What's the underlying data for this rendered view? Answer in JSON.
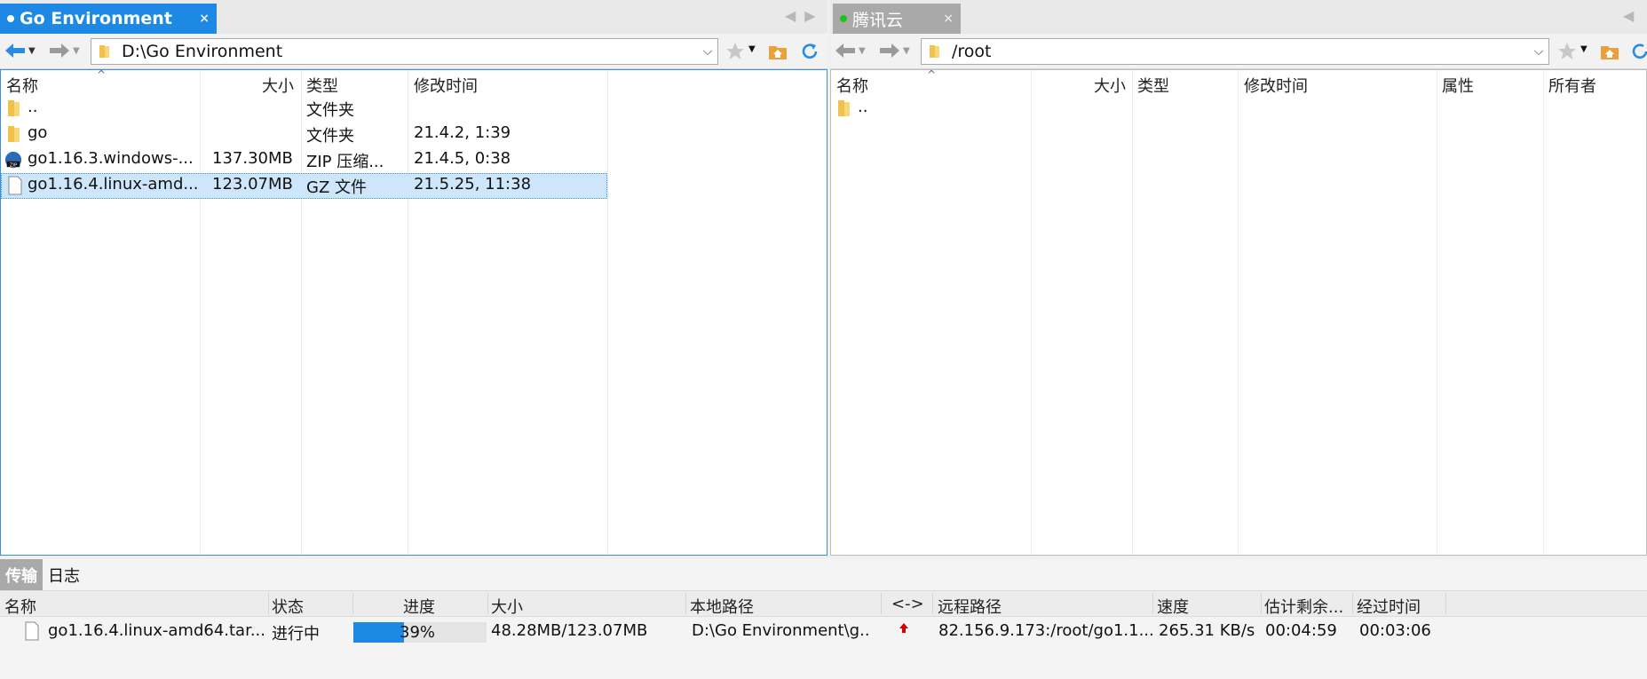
{
  "left": {
    "tab": {
      "label": "Go Environment",
      "close": "×"
    },
    "path": "D:\\Go Environment",
    "columns": {
      "name": "名称",
      "size": "大小",
      "type": "类型",
      "modified": "修改时间"
    },
    "files": [
      {
        "name": "..",
        "size": "",
        "type": "文件夹",
        "modified": "",
        "icon": "folder-icon"
      },
      {
        "name": "go",
        "size": "",
        "type": "文件夹",
        "modified": "21.4.2, 1:39",
        "icon": "folder-icon"
      },
      {
        "name": "go1.16.3.windows-...",
        "size": "137.30MB",
        "type": "ZIP 压缩...",
        "modified": "21.4.5, 0:38",
        "icon": "zip-file-icon"
      },
      {
        "name": "go1.16.4.linux-amd...",
        "size": "123.07MB",
        "type": "GZ 文件",
        "modified": "21.5.25, 11:38",
        "icon": "file-icon",
        "selected": true
      }
    ]
  },
  "right": {
    "tab": {
      "label": "腾讯云",
      "close": "×"
    },
    "path": "/root",
    "columns": {
      "name": "名称",
      "size": "大小",
      "type": "类型",
      "modified": "修改时间",
      "attr": "属性",
      "owner": "所有者"
    },
    "files": [
      {
        "name": "..",
        "icon": "folder-icon"
      }
    ]
  },
  "bottom": {
    "tabs": [
      "传输",
      "日志"
    ],
    "columns": {
      "name": "名称",
      "status": "状态",
      "progress": "进度",
      "size": "大小",
      "local": "本地路径",
      "dir": "<->",
      "remote": "远程路径",
      "speed": "速度",
      "eta": "估计剩余...",
      "elapsed": "经过时间"
    },
    "transfer": {
      "name": "go1.16.4.linux-amd64.tar...",
      "status": "进行中",
      "progress_percent": 39,
      "progress_label": "39%",
      "size": "48.28MB/123.07MB",
      "local": "D:\\Go Environment\\g..",
      "remote": "82.156.9.173:/root/go1.1...",
      "speed": "265.31 KB/s",
      "eta": "00:04:59",
      "elapsed": "00:03:06"
    }
  },
  "colors": {
    "accent": "#1e88e5",
    "selection": "#cde6fb",
    "upload_arrow": "#d40000",
    "online_dot": "#1ec41e"
  }
}
